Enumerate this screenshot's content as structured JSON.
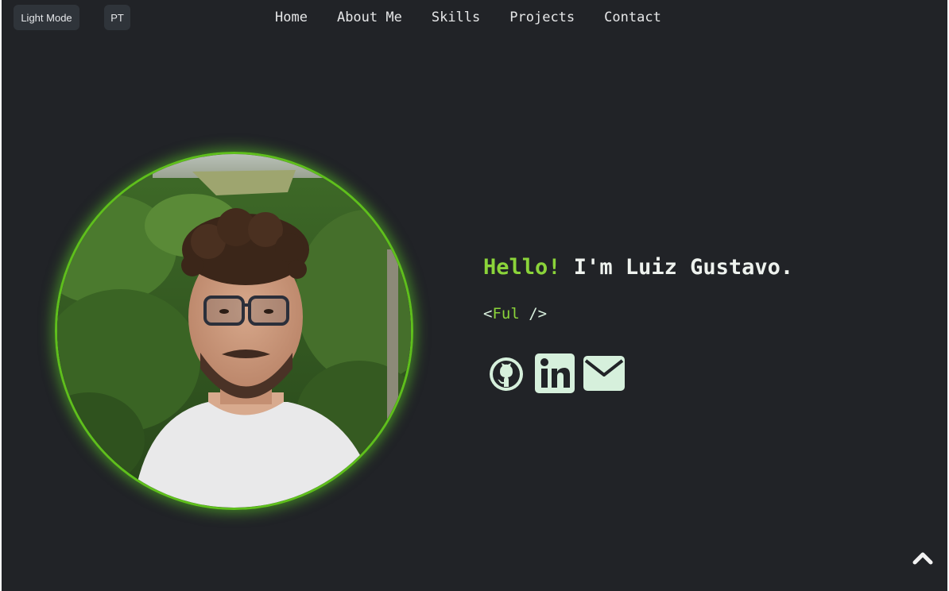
{
  "controls": {
    "theme_toggle": "Light Mode",
    "language_toggle": "PT"
  },
  "nav": {
    "items": [
      "Home",
      "About Me",
      "Skills",
      "Projects",
      "Contact"
    ]
  },
  "hero": {
    "greeting_highlight": "Hello!",
    "greeting_rest": " I'm Luiz Gustavo.",
    "tag_open": "<",
    "tag_word": "Ful",
    "tag_close": " />"
  },
  "colors": {
    "background": "#212327",
    "accent": "#8bd43a",
    "ring": "#5fbf1c",
    "icon": "#d6f0dc"
  },
  "icons": {
    "socials": [
      "github-icon",
      "linkedin-icon",
      "email-icon"
    ],
    "scroll": "chevron-up-icon"
  }
}
